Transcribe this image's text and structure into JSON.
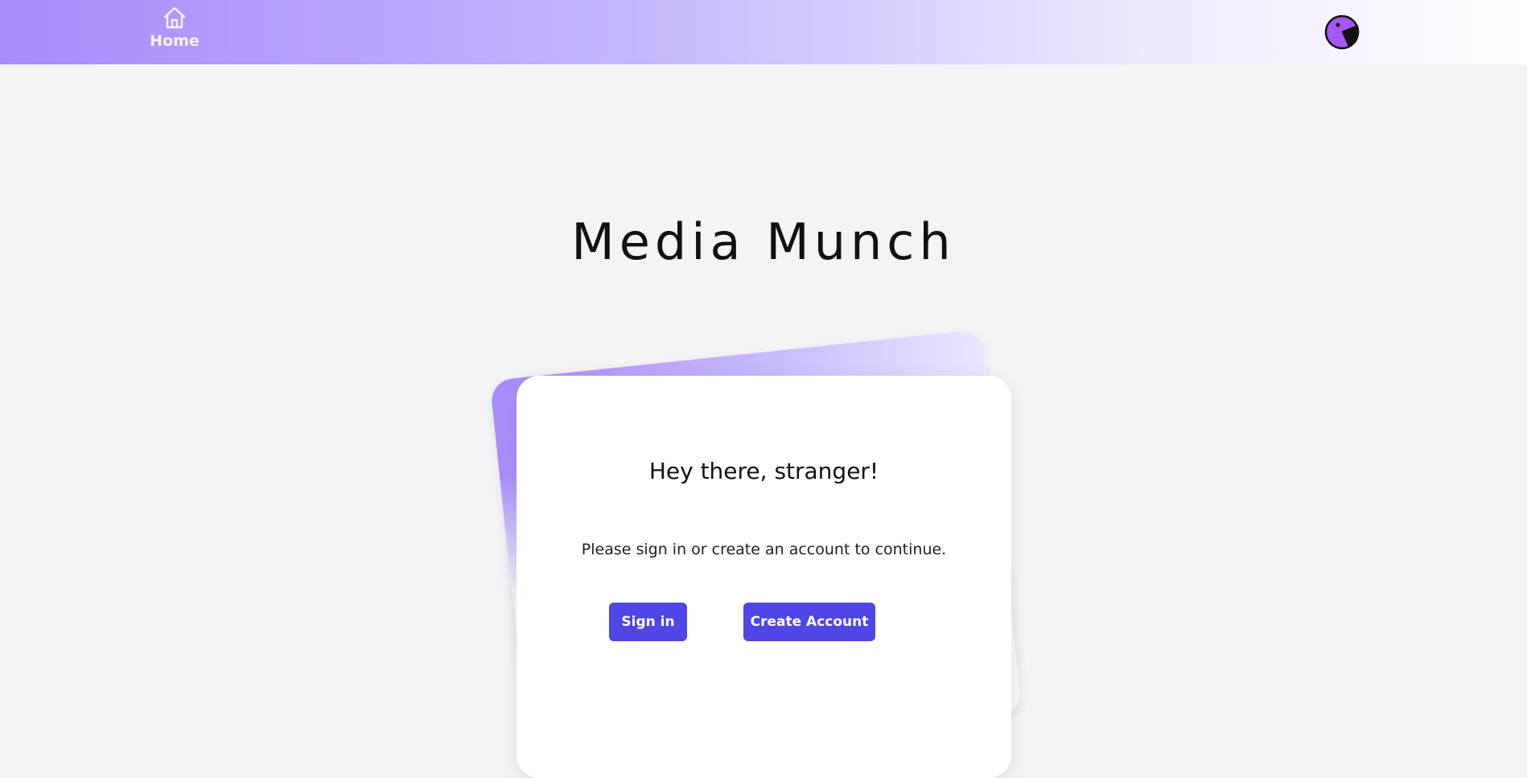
{
  "nav": {
    "home_label": "Home",
    "home_icon": "home-icon",
    "avatar_icon": "pacman-avatar-icon"
  },
  "page": {
    "title": "Media Munch"
  },
  "card": {
    "greeting": "Hey there, stranger!",
    "message": "Please sign in or create an account to continue.",
    "sign_in_label": "Sign in",
    "create_account_label": "Create Account"
  },
  "colors": {
    "accent": "#4f46e5",
    "gradient_start": "#a78bfa",
    "background": "#f3f4f6",
    "avatar_fill": "#a855f7"
  }
}
